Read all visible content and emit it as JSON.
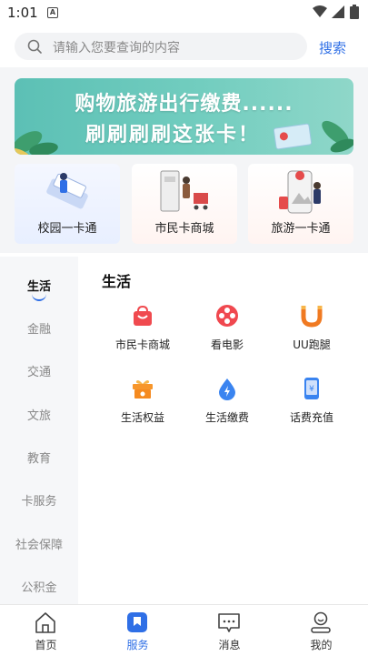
{
  "status_bar": {
    "time": "1:01",
    "notif_letter": "A"
  },
  "search": {
    "placeholder": "请输入您要查询的内容",
    "button": "搜索"
  },
  "banner": {
    "line1": "购物旅游出行缴费......",
    "line2": "刷刷刷刷这张卡！"
  },
  "quick_cards": [
    {
      "label": "校园一卡通",
      "icon": "campus-card-icon"
    },
    {
      "label": "市民卡商城",
      "icon": "mall-icon"
    },
    {
      "label": "旅游一卡通",
      "icon": "travel-icon"
    }
  ],
  "sidebar": {
    "items": [
      "生活",
      "金融",
      "交通",
      "文旅",
      "教育",
      "卡服务",
      "社会保障",
      "公积金"
    ],
    "active": "生活"
  },
  "content": {
    "title": "生活",
    "services": [
      {
        "label": "市民卡商城",
        "icon": "shopping-bag-icon",
        "color": "#f04a4f"
      },
      {
        "label": "看电影",
        "icon": "film-reel-icon",
        "color": "#f0484f"
      },
      {
        "label": "UU跑腿",
        "icon": "magnet-icon",
        "color": "#f07a22"
      },
      {
        "label": "生活权益",
        "icon": "gift-icon",
        "color": "#f7962b"
      },
      {
        "label": "生活缴费",
        "icon": "water-drop-icon",
        "color": "#3a84f0"
      },
      {
        "label": "话费充值",
        "icon": "phone-recharge-icon",
        "color": "#3a84f0"
      }
    ]
  },
  "tabbar": {
    "items": [
      {
        "label": "首页",
        "icon": "home-icon"
      },
      {
        "label": "服务",
        "icon": "service-icon"
      },
      {
        "label": "消息",
        "icon": "message-icon"
      },
      {
        "label": "我的",
        "icon": "profile-icon"
      }
    ],
    "active": "服务"
  },
  "colors": {
    "accent": "#2f6fe6",
    "sidebar_bg": "#f6f7f9",
    "banner_bg": "#6cc8bb"
  }
}
